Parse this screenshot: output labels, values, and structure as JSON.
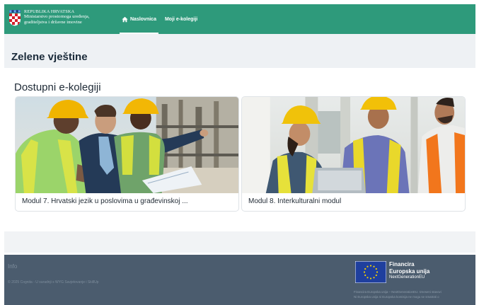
{
  "header": {
    "brand_line1": "REPUBLIKA HRVATSKA",
    "brand_line2": "Ministarstvo prostornoga uređenja,",
    "brand_line3": "graditeljstva i državne imovine",
    "nav": [
      {
        "label": "Naslovnica",
        "icon": "home-icon",
        "active": true
      },
      {
        "label": "Moji e-kolegiji",
        "active": false
      }
    ]
  },
  "page": {
    "title": "Zelene vještine",
    "section_title": "Dostupni e-kolegiji"
  },
  "courses": [
    {
      "title": "Modul 7. Hrvatski jezik u poslovima u građevinskoj ..."
    },
    {
      "title": "Modul 8. Interkulturalni modul"
    }
  ],
  "footer": {
    "info": "Info",
    "copyright": "© 2025 Cognita - U suradnji s WYG Savjetovanje i SkillUp",
    "eu_line1": "Financira",
    "eu_line2": "Europska unija",
    "eu_line3": "NextGenerationEU",
    "note_line1": "Financira Europska unija – NextGenerationEU. Izneseni stavovi",
    "note_line2": "Ni Europska unija ni Europska komisija ne mogu se smatrati o"
  },
  "colors": {
    "header": "#2e9a7b",
    "footer": "#4b5c6e",
    "title_band": "#eef1f4",
    "eu_blue": "#1f3f9e",
    "eu_star": "#f5d000"
  }
}
